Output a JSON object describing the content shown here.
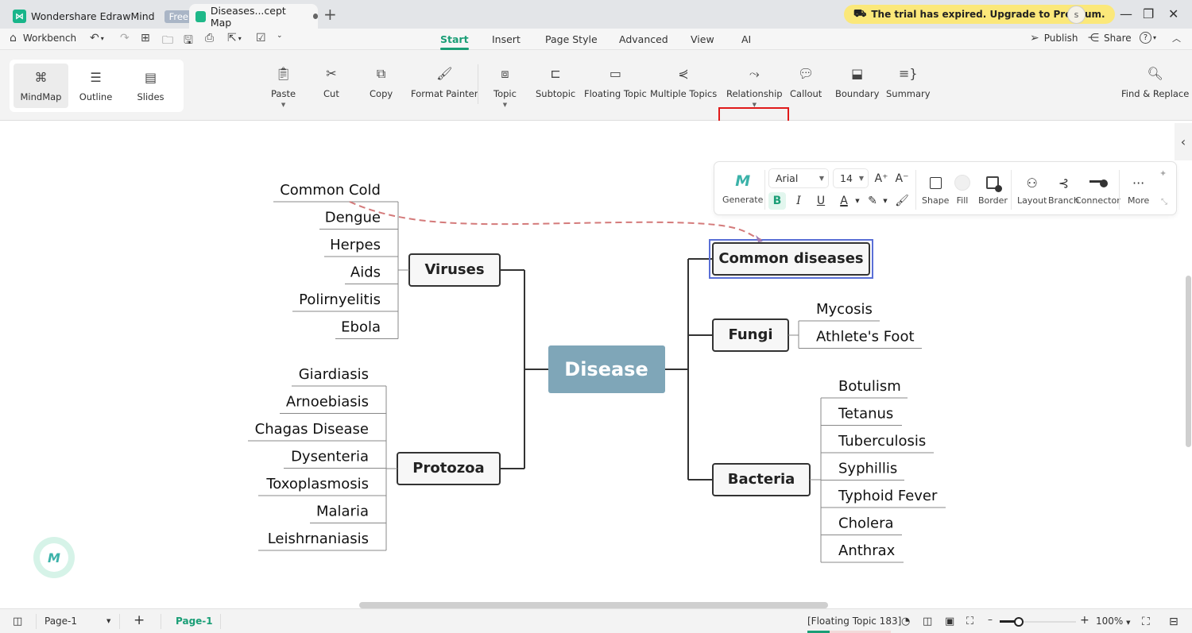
{
  "titlebar": {
    "app_tab": "Wondershare EdrawMind",
    "app_badge": "Free",
    "doc_tab": "Diseases...cept Map",
    "trial_banner": "The trial has expired. Upgrade to Premium.",
    "avatar_initial": "s",
    "icons": {
      "new_tab": "+",
      "minimize": "—",
      "restore": "❐",
      "close": "✕",
      "cart": "🛒"
    }
  },
  "quickbar": {
    "workbench": "Workbench",
    "menu_tabs": [
      "Start",
      "Insert",
      "Page Style",
      "Advanced",
      "View",
      "AI"
    ],
    "active_tab": "Start",
    "publish": "Publish",
    "share": "Share",
    "help": "?"
  },
  "ribbon": {
    "views": [
      {
        "label": "MindMap",
        "icon": "mindmap-icon",
        "active": true
      },
      {
        "label": "Outline",
        "icon": "outline-icon",
        "active": false
      },
      {
        "label": "Slides",
        "icon": "slides-icon",
        "active": false
      }
    ],
    "buttons": [
      {
        "label": "Paste",
        "icon": "paste-icon",
        "dropdown": true
      },
      {
        "label": "Cut",
        "icon": "cut-icon",
        "dropdown": false
      },
      {
        "label": "Copy",
        "icon": "copy-icon",
        "dropdown": false
      },
      {
        "label": "Format Painter",
        "icon": "format-painter-icon",
        "dropdown": false
      },
      {
        "label": "Topic",
        "icon": "topic-icon",
        "dropdown": true
      },
      {
        "label": "Subtopic",
        "icon": "subtopic-icon",
        "dropdown": false
      },
      {
        "label": "Floating Topic",
        "icon": "floating-topic-icon",
        "dropdown": false
      },
      {
        "label": "Multiple Topics",
        "icon": "multiple-topics-icon",
        "dropdown": false
      },
      {
        "label": "Relationship",
        "icon": "relationship-icon",
        "dropdown": true,
        "highlighted": true
      },
      {
        "label": "Callout",
        "icon": "callout-icon",
        "dropdown": false
      },
      {
        "label": "Boundary",
        "icon": "boundary-icon",
        "dropdown": false
      },
      {
        "label": "Summary",
        "icon": "summary-icon",
        "dropdown": false
      },
      {
        "label": "Find & Replace",
        "icon": "find-replace-icon",
        "dropdown": false
      }
    ]
  },
  "floating_toolbar": {
    "generate": "Generate",
    "font_family": "Arial",
    "font_size": "14",
    "grow": "A⁺",
    "shrink": "A⁻",
    "bold": "B",
    "italic": "I",
    "underline": "U",
    "font_color": "A",
    "shape": "Shape",
    "fill": "Fill",
    "border": "Border",
    "layout": "Layout",
    "branch": "Branch",
    "connector": "Connector",
    "more": "More",
    "more_glyph": "···"
  },
  "mindmap": {
    "central": "Disease",
    "central_color": "#7fa6b8",
    "relationship_color": "#d47a7a",
    "selection_color": "#5a6fd6",
    "left_branches": [
      {
        "title": "Viruses",
        "children": [
          "Common Cold",
          "Dengue",
          "Herpes",
          "Aids",
          "Polirnyelitis",
          "Ebola"
        ]
      },
      {
        "title": "Protozoa",
        "children": [
          "Giardiasis",
          "Arnoebiasis",
          "Chagas Disease",
          "Dysenteria",
          "Toxoplasmosis",
          "Malaria",
          "Leishrnaniasis"
        ]
      }
    ],
    "right_branches": [
      {
        "title": "Common diseases",
        "children": [],
        "selected": true
      },
      {
        "title": "Fungi",
        "children": [
          "Mycosis",
          "Athlete's Foot"
        ]
      },
      {
        "title": "Bacteria",
        "children": [
          "Botulism",
          "Tetanus",
          "Tuberculosis",
          "Syphillis",
          "Typhoid Fever",
          "Cholera",
          "Anthrax"
        ]
      }
    ],
    "relationship": {
      "from": "Common Cold",
      "to": "Common diseases"
    }
  },
  "statusbar": {
    "page_select": "Page-1",
    "add_page": "+",
    "page_tab": "Page-1",
    "selection_info": "[Floating Topic 183]",
    "zoom": "100%",
    "zoom_fraction": 0.25,
    "progress_fraction": 0.27
  }
}
